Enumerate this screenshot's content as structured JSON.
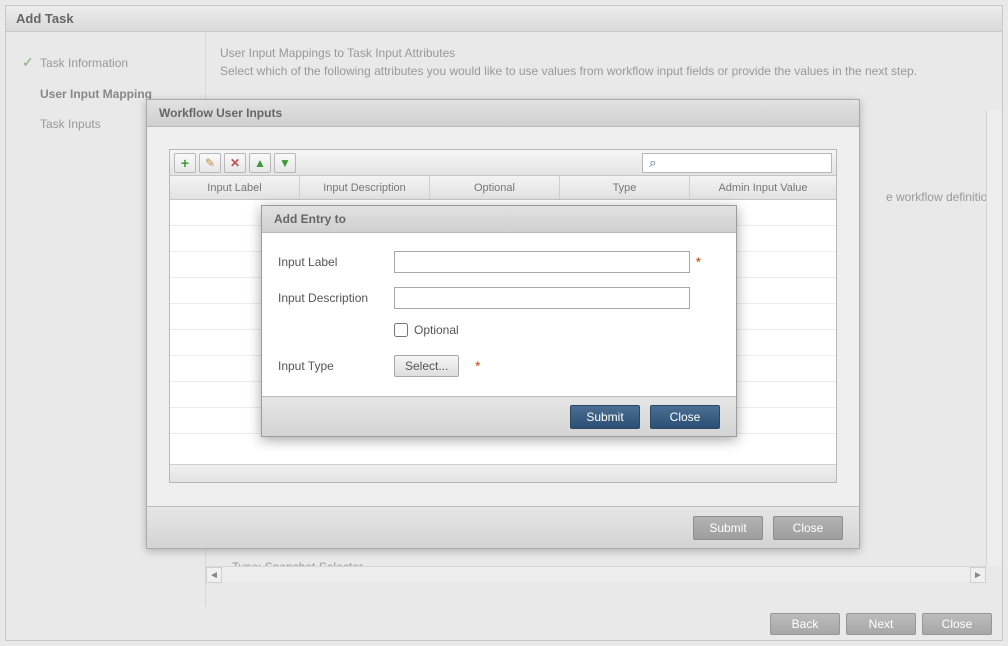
{
  "main": {
    "title": "Add Task",
    "steps": [
      {
        "label": "Task Information",
        "done": true
      },
      {
        "label": "User Input Mapping",
        "active": true
      },
      {
        "label": "Task Inputs"
      }
    ],
    "intro_line1": "User Input Mappings to Task Input Attributes",
    "intro_line2": "Select which of the following attributes you would like to use values from workflow input fields or provide the values in the next step.",
    "bg_hint": "e workflow definition",
    "snippet_line2": "Type: Snapshot Selector",
    "footer": {
      "back": "Back",
      "next": "Next",
      "close": "Close"
    }
  },
  "dialog1": {
    "title": "Workflow User Inputs",
    "columns": [
      "Input Label",
      "Input Description",
      "Optional",
      "Type",
      "Admin Input Value"
    ],
    "search_placeholder": "",
    "footer": {
      "submit": "Submit",
      "close": "Close"
    }
  },
  "dialog2": {
    "title": "Add Entry to",
    "labels": {
      "input_label": "Input Label",
      "input_description": "Input Description",
      "optional": "Optional",
      "input_type": "Input Type",
      "select_btn": "Select..."
    },
    "values": {
      "input_label": "",
      "input_description": ""
    },
    "footer": {
      "submit": "Submit",
      "close": "Close"
    }
  }
}
